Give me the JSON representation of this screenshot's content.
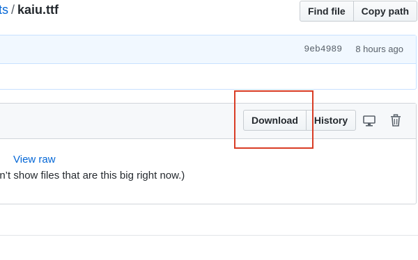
{
  "breadcrumb": {
    "parent_fragment": "ts",
    "separator": "/",
    "file_name": "kaiu.ttf"
  },
  "top_actions": {
    "find_file": "Find file",
    "copy_path": "Copy path"
  },
  "commit": {
    "sha": "9eb4989",
    "time": "8 hours ago"
  },
  "file_actions": {
    "download": "Download",
    "history": "History"
  },
  "file_body": {
    "view_raw": "View raw",
    "message": "an’t show files that are this big right now.)"
  },
  "icons": [
    "desktop-monitor-icon",
    "trash-icon"
  ],
  "colors": {
    "link": "#0366d6",
    "highlight": "#d93c24",
    "commit_bar": "#f1f8ff",
    "header_bg": "#f6f8fa"
  }
}
